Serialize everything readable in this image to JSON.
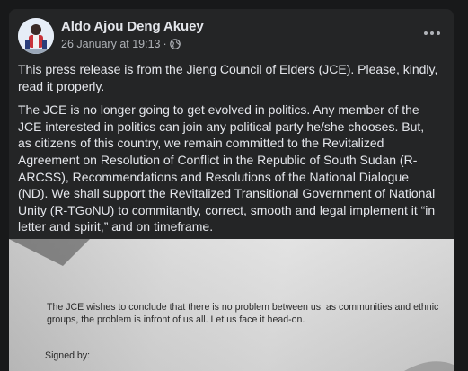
{
  "post": {
    "author": "Aldo Ajou Deng Akuey",
    "timestamp": "26 January at 19:13",
    "separator": "·",
    "privacy_icon": "globe-icon",
    "more_icon": "ellipsis-icon",
    "paragraphs": [
      "This press release is from the Jieng Council of Elders (JCE). Please, kindly, read it properly.",
      "The JCE is no longer going to get evolved in politics. Any member of the JCE interested in politics can join any political party he/she chooses. But, as citizens of this country, we remain committed to the Revitalized Agreement on Resolution of Conflict in the Republic of South Sudan (R-ARCSS), Recommendations and Resolutions of the National Dialogue (ND). We shall support the Revitalized Transitional Government of National Unity (R-TGoNU) to commitantly, correct, smooth and legal implement it “in letter and spirit,” and on timeframe."
    ]
  },
  "photo": {
    "doc_text": "The JCE wishes to conclude that there is no problem between us, as communities and ethnic groups, the problem is infront of us all. Let us face it head-on.",
    "signed_by": "Signed by:"
  },
  "colors": {
    "page_bg": "#18191a",
    "card_bg": "#242526",
    "primary_text": "#e4e6eb",
    "secondary_text": "#b0b3b8"
  }
}
